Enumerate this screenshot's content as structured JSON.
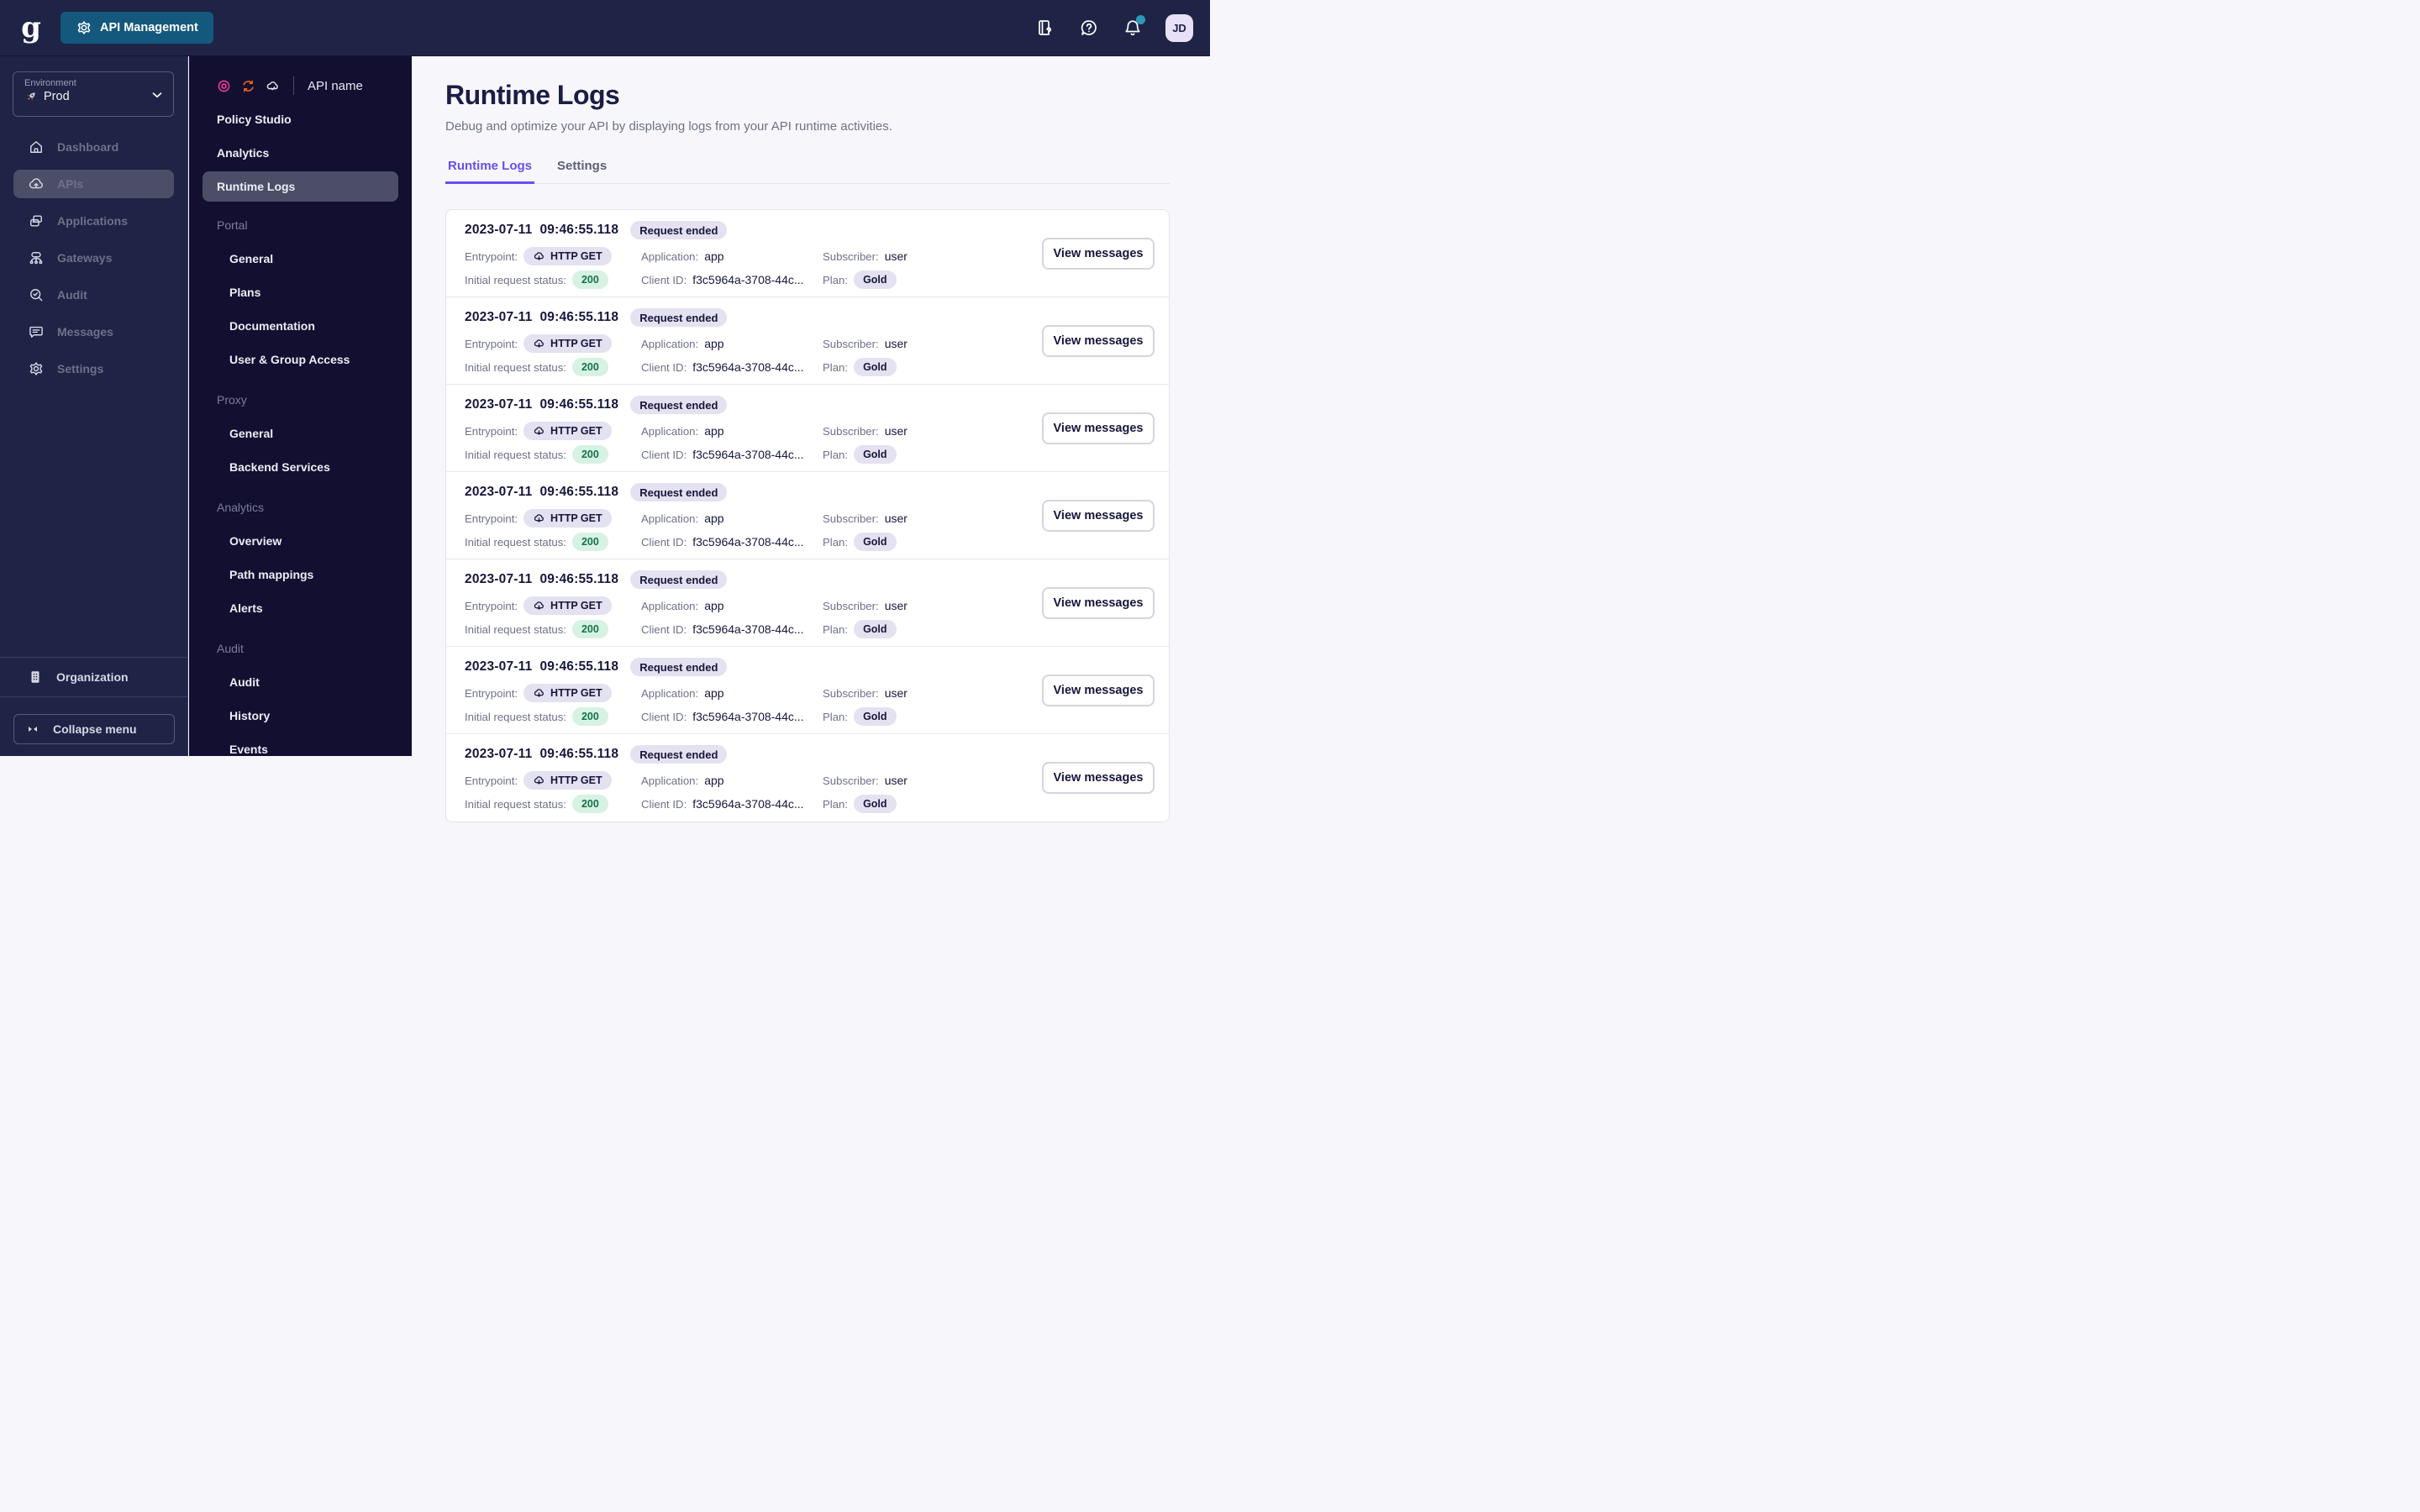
{
  "topbar": {
    "logo_letter": "g",
    "context_button": {
      "label": "API Management"
    },
    "avatar_initials": "JD"
  },
  "sidebar": {
    "environment": {
      "label": "Environment",
      "value": "Prod"
    },
    "items": [
      {
        "label": "Dashboard",
        "icon": "home-icon",
        "active": false
      },
      {
        "label": "APIs",
        "icon": "cloud-icon",
        "active": true
      },
      {
        "label": "Applications",
        "icon": "applications-icon",
        "active": false
      },
      {
        "label": "Gateways",
        "icon": "gateways-icon",
        "active": false
      },
      {
        "label": "Audit",
        "icon": "audit-icon",
        "active": false
      },
      {
        "label": "Messages",
        "icon": "messages-icon",
        "active": false
      },
      {
        "label": "Settings",
        "icon": "gear-icon",
        "active": false
      }
    ],
    "organization_label": "Organization",
    "collapse_label": "Collapse menu"
  },
  "api_menu": {
    "api_name": "API name",
    "top_items": [
      {
        "label": "Policy Studio",
        "active": false
      },
      {
        "label": "Analytics",
        "active": false
      },
      {
        "label": "Runtime Logs",
        "active": true
      }
    ],
    "sections": [
      {
        "title": "Portal",
        "items": [
          {
            "label": "General"
          },
          {
            "label": "Plans"
          },
          {
            "label": "Documentation"
          },
          {
            "label": "User & Group Access"
          }
        ]
      },
      {
        "title": "Proxy",
        "items": [
          {
            "label": "General"
          },
          {
            "label": "Backend Services"
          }
        ]
      },
      {
        "title": "Analytics",
        "items": [
          {
            "label": "Overview"
          },
          {
            "label": "Path mappings"
          },
          {
            "label": "Alerts"
          }
        ]
      },
      {
        "title": "Audit",
        "items": [
          {
            "label": "Audit"
          },
          {
            "label": "History"
          },
          {
            "label": "Events"
          }
        ]
      }
    ]
  },
  "main": {
    "title": "Runtime Logs",
    "subtitle": "Debug and optimize your API by displaying logs from your API runtime activities.",
    "tabs": [
      {
        "label": "Runtime Logs",
        "active": true
      },
      {
        "label": "Settings",
        "active": false
      }
    ],
    "logs": {
      "labels": {
        "entrypoint": "Entrypoint:",
        "status": "Initial request status:",
        "application": "Application:",
        "client_id": "Client ID:",
        "subscriber": "Subscriber:",
        "plan": "Plan:"
      },
      "view_messages_label": "View messages",
      "entries": [
        {
          "date": "2023-07-11",
          "time": "09:46:55.118",
          "event": "Request ended",
          "method": "HTTP GET",
          "status_code": "200",
          "application": "app",
          "client_id": "f3c5964a-3708-44c...",
          "subscriber": "user",
          "plan": "Gold"
        },
        {
          "date": "2023-07-11",
          "time": "09:46:55.118",
          "event": "Request ended",
          "method": "HTTP GET",
          "status_code": "200",
          "application": "app",
          "client_id": "f3c5964a-3708-44c...",
          "subscriber": "user",
          "plan": "Gold"
        },
        {
          "date": "2023-07-11",
          "time": "09:46:55.118",
          "event": "Request ended",
          "method": "HTTP GET",
          "status_code": "200",
          "application": "app",
          "client_id": "f3c5964a-3708-44c...",
          "subscriber": "user",
          "plan": "Gold"
        },
        {
          "date": "2023-07-11",
          "time": "09:46:55.118",
          "event": "Request ended",
          "method": "HTTP GET",
          "status_code": "200",
          "application": "app",
          "client_id": "f3c5964a-3708-44c...",
          "subscriber": "user",
          "plan": "Gold"
        },
        {
          "date": "2023-07-11",
          "time": "09:46:55.118",
          "event": "Request ended",
          "method": "HTTP GET",
          "status_code": "200",
          "application": "app",
          "client_id": "f3c5964a-3708-44c...",
          "subscriber": "user",
          "plan": "Gold"
        },
        {
          "date": "2023-07-11",
          "time": "09:46:55.118",
          "event": "Request ended",
          "method": "HTTP GET",
          "status_code": "200",
          "application": "app",
          "client_id": "f3c5964a-3708-44c...",
          "subscriber": "user",
          "plan": "Gold"
        },
        {
          "date": "2023-07-11",
          "time": "09:46:55.118",
          "event": "Request ended",
          "method": "HTTP GET",
          "status_code": "200",
          "application": "app",
          "client_id": "f3c5964a-3708-44c...",
          "subscriber": "user",
          "plan": "Gold"
        }
      ]
    }
  },
  "colors": {
    "navy": "#1f2346",
    "api_menu_bg": "#130f31",
    "accent_purple": "#6a4ef0",
    "context_button_blue": "#14587d",
    "badge_lavender": "#e4e1f0",
    "success_bg": "#d7f2e3",
    "success_text": "#15724a",
    "notification_dot": "#2f97b7",
    "record_pink": "#f03d97",
    "sync_orange": "#f4611c"
  }
}
